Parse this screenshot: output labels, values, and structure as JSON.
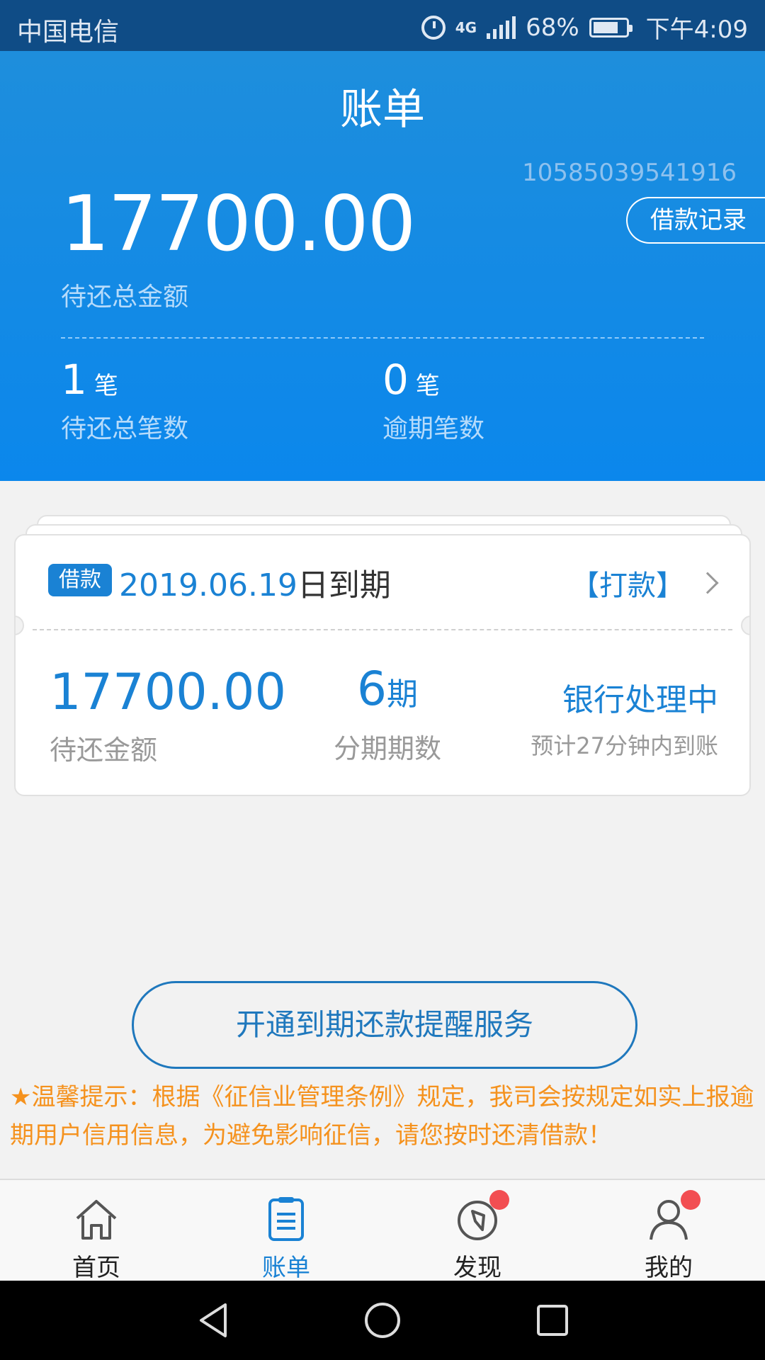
{
  "status_bar": {
    "carrier": "中国电信",
    "network": "4G",
    "battery": "68%",
    "time": "下午4:09"
  },
  "header": {
    "title": "账单",
    "account_number": "10585039541916",
    "record_button": "借款记录",
    "total_amount": "17700.00",
    "total_label": "待还总金额",
    "pending_count": "1",
    "pending_unit": "笔",
    "pending_label": "待还总笔数",
    "overdue_count": "0",
    "overdue_unit": "笔",
    "overdue_label": "逾期笔数"
  },
  "card": {
    "badge": "借款",
    "due_date": "2019.06.19",
    "due_suffix": "日到期",
    "action": "【打款】",
    "amount": "17700.00",
    "amount_label": "待还金额",
    "periods": "6",
    "periods_unit": "期",
    "periods_label": "分期期数",
    "status": "银行处理中",
    "status_sub": "预计27分钟内到账"
  },
  "reminder_button": "开通到期还款提醒服务",
  "tip": "★温馨提示：根据《征信业管理条例》规定，我司会按规定如实上报逾期用户信用信息，为避免影响征信，请您按时还清借款！",
  "nav": [
    {
      "label": "首页",
      "icon": "home-icon"
    },
    {
      "label": "账单",
      "icon": "bill-icon"
    },
    {
      "label": "发现",
      "icon": "compass-icon"
    },
    {
      "label": "我的",
      "icon": "user-icon"
    }
  ],
  "colors": {
    "primary": "#1a82d4",
    "header": "#0b87ec",
    "tip": "#f5921e",
    "badge_dot": "#f24e52"
  }
}
